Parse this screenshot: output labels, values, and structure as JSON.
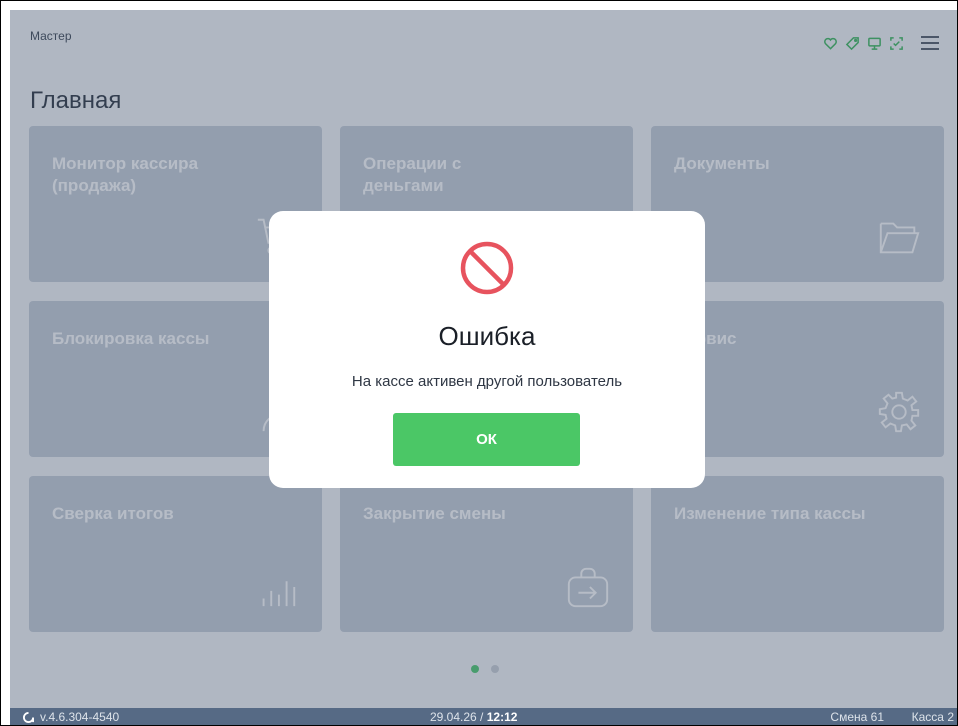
{
  "header": {
    "user": "Мастер",
    "status_icons": [
      "heart-icon",
      "tag-icon",
      "monitor-icon",
      "scan-icon"
    ],
    "menu_icon": "hamburger-menu-icon"
  },
  "page": {
    "title": "Главная"
  },
  "tiles": [
    {
      "label": "Монитор кассира\n(продажа)",
      "icon": "cart-icon"
    },
    {
      "label": "Операции с\nденьгами",
      "icon": "money-icon"
    },
    {
      "label": "Документы",
      "icon": "folder-icon"
    },
    {
      "label": "Блокировка кассы",
      "icon": "user-icon"
    },
    {
      "label": "",
      "icon": ""
    },
    {
      "label": "Сервис",
      "icon": "gear-icon"
    },
    {
      "label": "Сверка итогов",
      "icon": "bar-chart-icon"
    },
    {
      "label": "Закрытие смены",
      "icon": "exit-icon"
    },
    {
      "label": "Изменение типа кассы",
      "icon": ""
    }
  ],
  "pager": {
    "pages": 2,
    "current": 1
  },
  "footer": {
    "version": "v.4.6.304-4540",
    "date": "29.04.26 / ",
    "time": "12:12",
    "shift": "Смена 61",
    "register": "Касса 2"
  },
  "dialog": {
    "icon": "forbidden-icon",
    "title": "Ошибка",
    "message": "На кассе активен другой пользователь",
    "ok_label": "ОК"
  },
  "colors": {
    "accent_green": "#4bc766",
    "error_red": "#e7535e",
    "tile_bg": "#c3cbd6",
    "footer_bg": "#566a85"
  }
}
